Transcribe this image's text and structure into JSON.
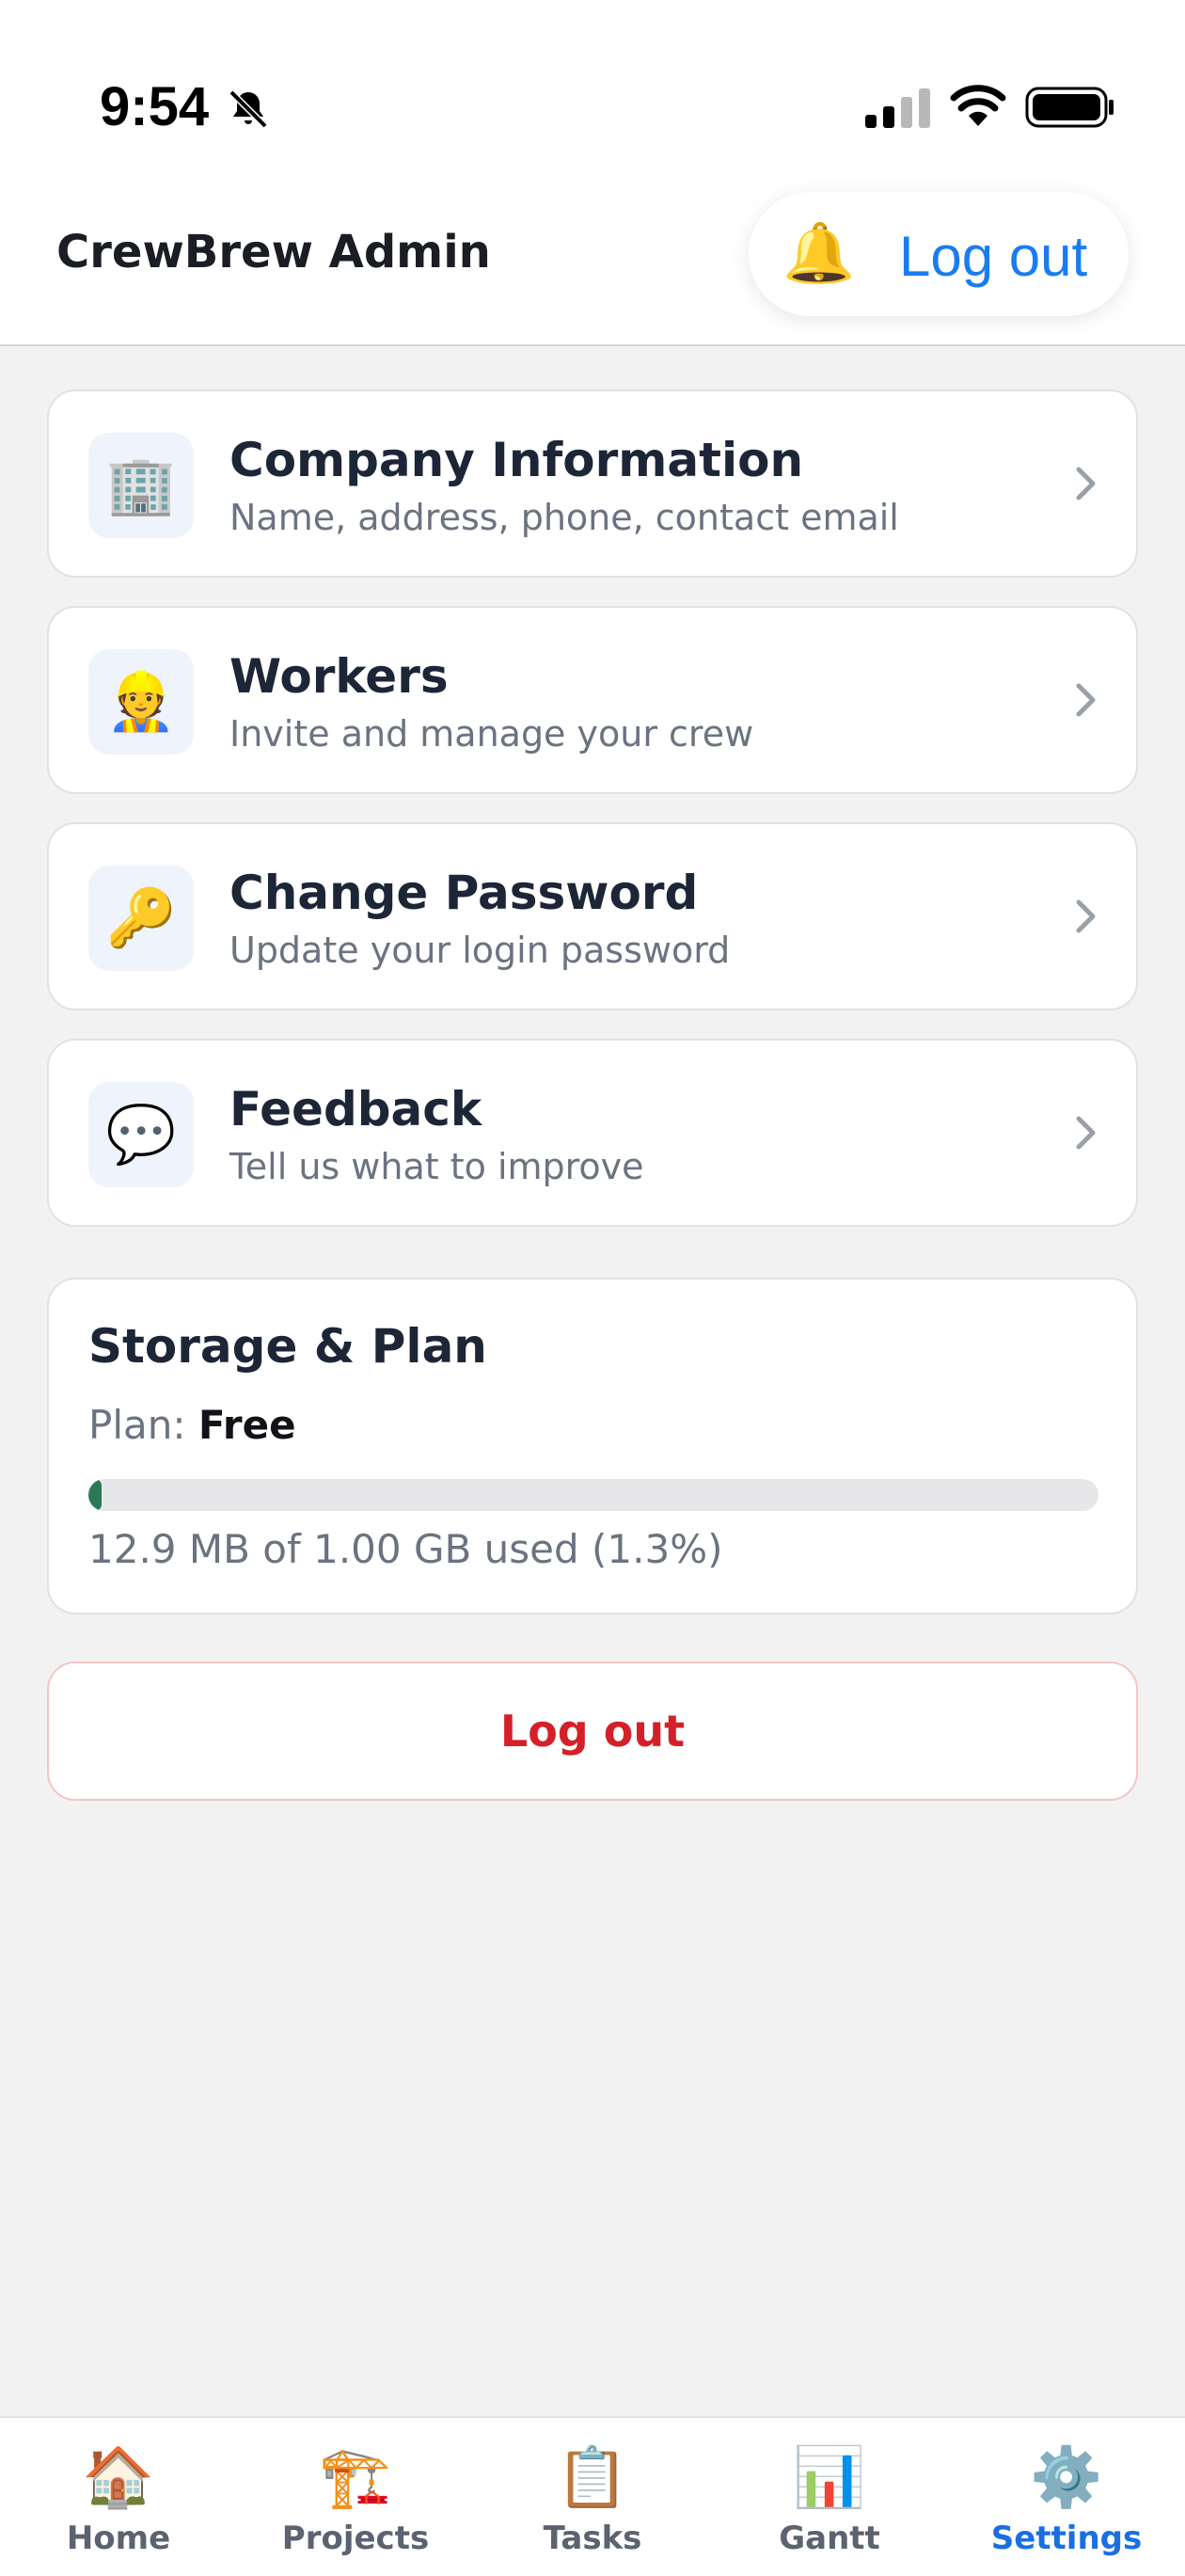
{
  "status_bar": {
    "time": "9:54"
  },
  "header": {
    "title": "CrewBrew Admin",
    "bell_icon": "🔔",
    "logout_label": "Log out"
  },
  "menu": [
    {
      "icon": "🏢",
      "title": "Company Information",
      "subtitle": "Name, address, phone, contact email"
    },
    {
      "icon": "👷",
      "title": "Workers",
      "subtitle": "Invite and manage your crew"
    },
    {
      "icon": "🔑",
      "title": "Change Password",
      "subtitle": "Update your login password"
    },
    {
      "icon": "💬",
      "title": "Feedback",
      "subtitle": "Tell us what to improve"
    }
  ],
  "storage": {
    "title": "Storage & Plan",
    "plan_label": "Plan:",
    "plan_value": "Free",
    "used_fraction": 0.013,
    "usage_text": "12.9 MB of 1.00 GB used (1.3%)"
  },
  "logout_button_label": "Log out",
  "tabs": [
    {
      "icon": "🏠",
      "label": "Home",
      "active": false
    },
    {
      "icon": "🏗️",
      "label": "Projects",
      "active": false
    },
    {
      "icon": "📋",
      "label": "Tasks",
      "active": false
    },
    {
      "icon": "📊",
      "label": "Gantt",
      "active": false
    },
    {
      "icon": "⚙️",
      "label": "Settings",
      "active": true
    }
  ],
  "colors": {
    "accent": "#1a7cf0",
    "danger": "#d5202a",
    "progress": "#2c7a55"
  }
}
